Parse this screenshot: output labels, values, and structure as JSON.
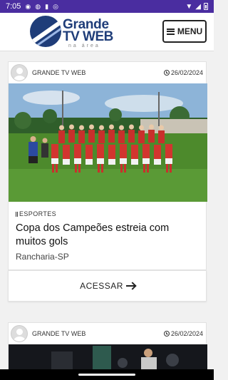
{
  "status_bar": {
    "time": "7:05"
  },
  "header": {
    "logo_line1": "Grande",
    "logo_line2": "TV WEB",
    "logo_tagline": "na área",
    "menu_label": "MENU"
  },
  "posts": [
    {
      "author": "GRANDE TV WEB",
      "date": "26/02/2024",
      "category": "ESPORTES",
      "title": "Copa dos Campeões estreia com muitos gols",
      "location": "Rancharia-SP",
      "access_label": "ACESSAR"
    },
    {
      "author": "GRANDE TV WEB",
      "date": "26/02/2024"
    }
  ],
  "colors": {
    "status_bar": "#4a2da0",
    "brand": "#1f3d79",
    "field_green": "#4d8a2c",
    "jersey_red": "#c9302c"
  }
}
